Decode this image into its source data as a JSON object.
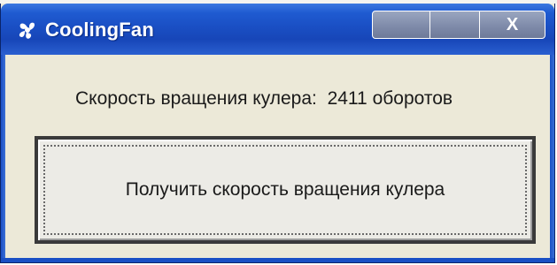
{
  "window": {
    "title": "CoolingFan",
    "icon": "cooling-fan-icon",
    "controls": {
      "minimize_icon": "minimize-icon",
      "maximize_icon": "maximize-icon",
      "close_label": "X"
    }
  },
  "main": {
    "speed_label": "Скорость вращения кулера:",
    "speed_value": "2411",
    "speed_unit": "оборотов",
    "get_speed_button": "Получить скорость вращения кулера"
  },
  "colors": {
    "titlebar": "#1a4fc4",
    "window_bg": "#ece9d8",
    "text": "#1a1a1a"
  }
}
